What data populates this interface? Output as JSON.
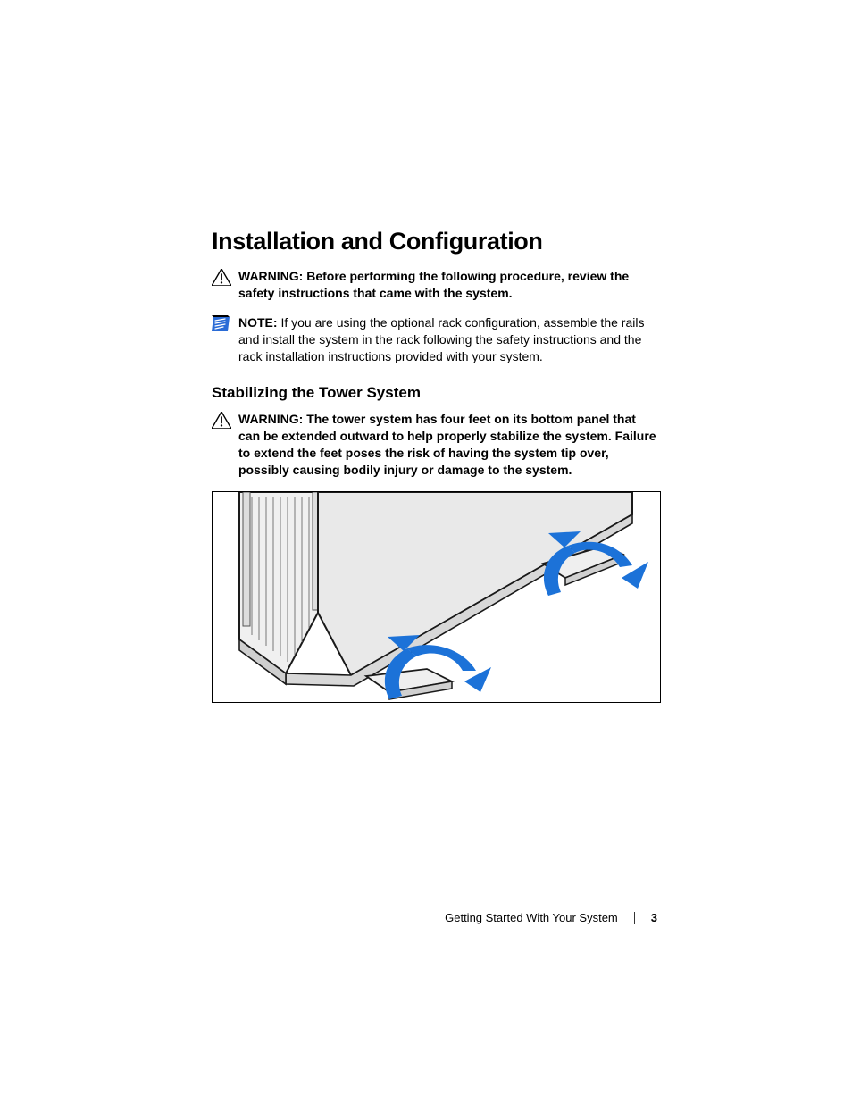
{
  "heading": "Installation and Configuration",
  "warning1": {
    "label": "WARNING:",
    "text": " Before performing the following procedure, review the safety instructions that came with the system."
  },
  "note1": {
    "label": "NOTE:",
    "text": " If you are using the optional rack configuration, assemble the rails and install the system in the rack following the safety instructions and the rack installation instructions provided with your system."
  },
  "subheading": "Stabilizing the Tower System",
  "warning2": {
    "label": "WARNING:",
    "text": " The tower system has four feet on its bottom panel that can be extended outward to help properly stabilize the system. Failure to extend the feet poses the risk of having the system tip over, possibly causing bodily injury or damage to the system."
  },
  "footer": {
    "section": "Getting Started With Your System",
    "page": "3"
  }
}
